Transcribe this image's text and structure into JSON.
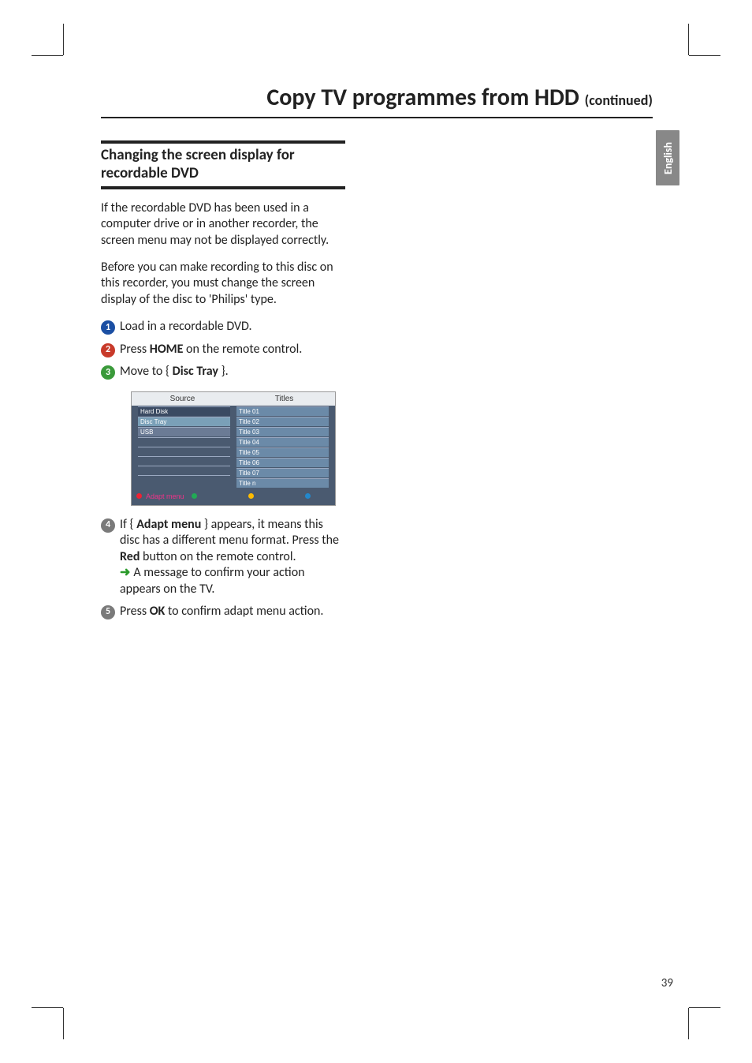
{
  "page": {
    "title_main": "Copy TV programmes from HDD",
    "title_cont": "(continued)",
    "side_tab": "English",
    "page_number": "39"
  },
  "section": {
    "heading": "Changing the screen display for recordable DVD",
    "para1": "If the recordable DVD has been used in a computer drive or in another recorder, the screen menu may not be displayed correctly.",
    "para2": "Before you can make recording to this disc on this recorder, you must change the screen display of the disc to 'Philips' type."
  },
  "steps": [
    {
      "num": "1",
      "text_before": "Load in a recordable DVD.",
      "bold": "",
      "text_after": ""
    },
    {
      "num": "2",
      "text_before": "Press ",
      "bold": "HOME",
      "text_after": " on the remote control."
    },
    {
      "num": "3",
      "text_before": "Move to { ",
      "bold": "Disc Tray",
      "text_after": " }."
    },
    {
      "num": "4",
      "text_before": "If { ",
      "bold": "Adapt menu",
      "text_after": " } appears, it means this disc has a different menu format.  Press the ",
      "bold2": "Red",
      "text_after2": " button on the remote control.",
      "sub_arrow": "A message to confirm your action appears on the TV."
    },
    {
      "num": "5",
      "text_before": "Press ",
      "bold": "OK",
      "text_after": " to confirm adapt menu action."
    }
  ],
  "figure": {
    "headers": [
      "Source",
      "Titles"
    ],
    "source_rows": [
      "Hard Disk",
      "Disc Tray",
      "USB",
      "",
      "",
      "",
      "",
      ""
    ],
    "title_rows": [
      "Title 01",
      "Title 02",
      "Title 03",
      "Title 04",
      "Title 05",
      "Title 06",
      "Title 07",
      "Title n"
    ],
    "footer_label": "Adapt menu"
  }
}
